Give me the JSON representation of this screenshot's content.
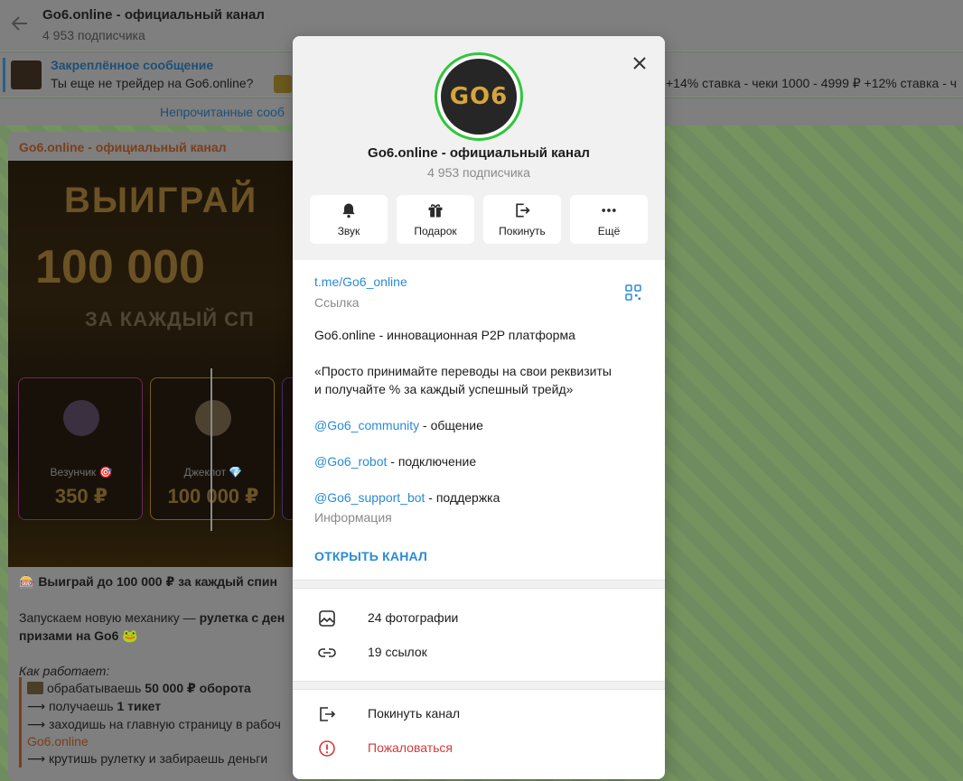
{
  "chat": {
    "header": {
      "title": "Go6.online - официальный канал",
      "subscribers": "4 953 подписчика"
    },
    "pinned": {
      "label": "Закреплённое сообщение",
      "text": "Ты еще не трейдер на Go6.online?",
      "text_right": "+14% ставка - чеки 1000 - 4999 ₽ +12% ставка - ч"
    },
    "unread_bar": "Непрочитанные сооб",
    "message": {
      "sender": "Go6.online - официальный канал",
      "promo_line1": "ВЫИГРАЙ",
      "promo_line2": "100 000",
      "promo_line3": "ЗА КАЖДЫЙ СП",
      "cards": [
        {
          "name": "Везунчик 🎯",
          "value": "350 ₽"
        },
        {
          "name": "Джекпот 💎",
          "value": "100 000 ₽"
        },
        {
          "name": "",
          "value": ""
        }
      ],
      "headline": "🎰 Выиграй до 100 000 ₽ за каждый спин",
      "p1_start": "Запускаем новую механику — ",
      "p1_bold": "рулетка с ден",
      "p1_line2": "призами на Go6 🐸",
      "how_title": "Как работает:",
      "step1_pre": "обрабатываешь ",
      "step1_bold": "50 000 ₽ оборота",
      "step2_pre": "⟶ получаешь ",
      "step2_bold": "1 тикет",
      "step3": "⟶ заходишь на главную страницу в рабоч",
      "step3_link": "Go6.online",
      "step4": "⟶ крутишь рулетку и забираешь деньги"
    }
  },
  "modal": {
    "avatar_text": "GO6",
    "title": "Go6.online - официальный канал",
    "subscribers": "4 953 подписчика",
    "actions": [
      {
        "label": "Звук",
        "icon": "bell-icon"
      },
      {
        "label": "Подарок",
        "icon": "gift-icon"
      },
      {
        "label": "Покинуть",
        "icon": "leave-icon"
      },
      {
        "label": "Ещё",
        "icon": "more-icon"
      }
    ],
    "link": "t.me/Go6_online",
    "link_label": "Ссылка",
    "description": {
      "line1": "Go6.online - инновационная P2P платформа",
      "line2": "«Просто принимайте переводы на свои реквизиты",
      "line3": "и получайте % за каждый успешный трейд»",
      "community_mention": "@Go6_community",
      "community_text": " - общение",
      "robot_mention": "@Go6_robot",
      "robot_text": " - подключение",
      "support_mention": "@Go6_support_bot",
      "support_text": " - поддержка"
    },
    "info_label": "Информация",
    "open_channel": "ОТКРЫТЬ КАНАЛ",
    "media": [
      {
        "label": "24 фотографии",
        "icon": "photo-icon"
      },
      {
        "label": "19 ссылок",
        "icon": "link-icon"
      }
    ],
    "bottom": [
      {
        "label": "Покинуть канал",
        "icon": "leave-icon"
      },
      {
        "label": "Пожаловаться",
        "icon": "report-icon"
      }
    ],
    "colors": {
      "accent": "#2a8bd6",
      "danger": "#d23b3b",
      "avatar_ring": "#2fc63a"
    }
  }
}
